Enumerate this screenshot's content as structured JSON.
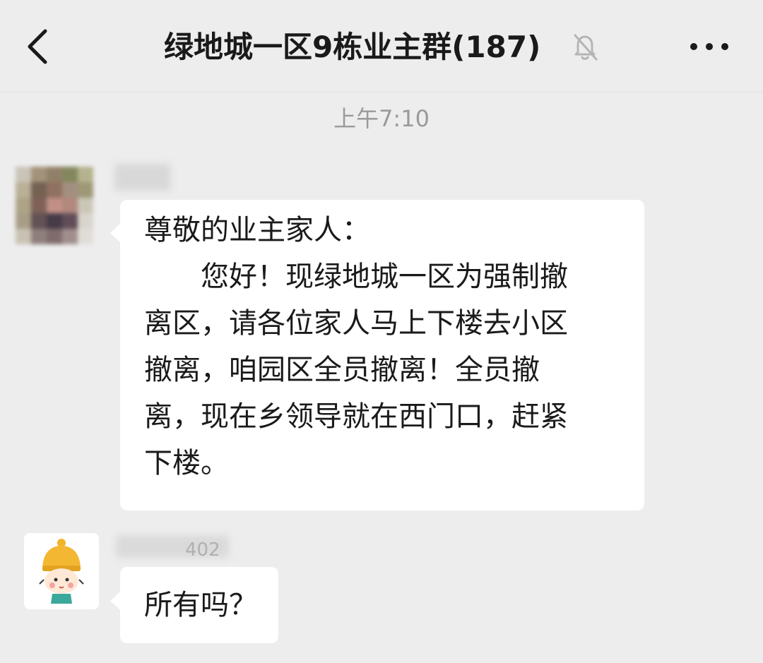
{
  "header": {
    "title": "绿地城一区9栋业主群(187)",
    "back_icon": "chevron-left-icon",
    "mute_icon": "bell-off-icon",
    "more_icon": "more-dots-icon"
  },
  "chat": {
    "timestamp": "上午7:10",
    "messages": [
      {
        "sender_name_blurred": true,
        "lines": [
          "尊敬的业主家人：",
          "　　您好！现绿地城一区为强制撤",
          "离区，请各位家人马上下楼去小区",
          "撤离，咱园区全员撤离！全员撤",
          "离，现在乡领导就在西门口，赶紧",
          "下楼。"
        ]
      },
      {
        "sender_name_partial": "402",
        "lines": [
          "所有吗？"
        ]
      }
    ]
  },
  "colors": {
    "background": "#ededed",
    "bubble": "#ffffff",
    "text": "#1a1a1a",
    "timestamp": "#9a9a9a"
  }
}
